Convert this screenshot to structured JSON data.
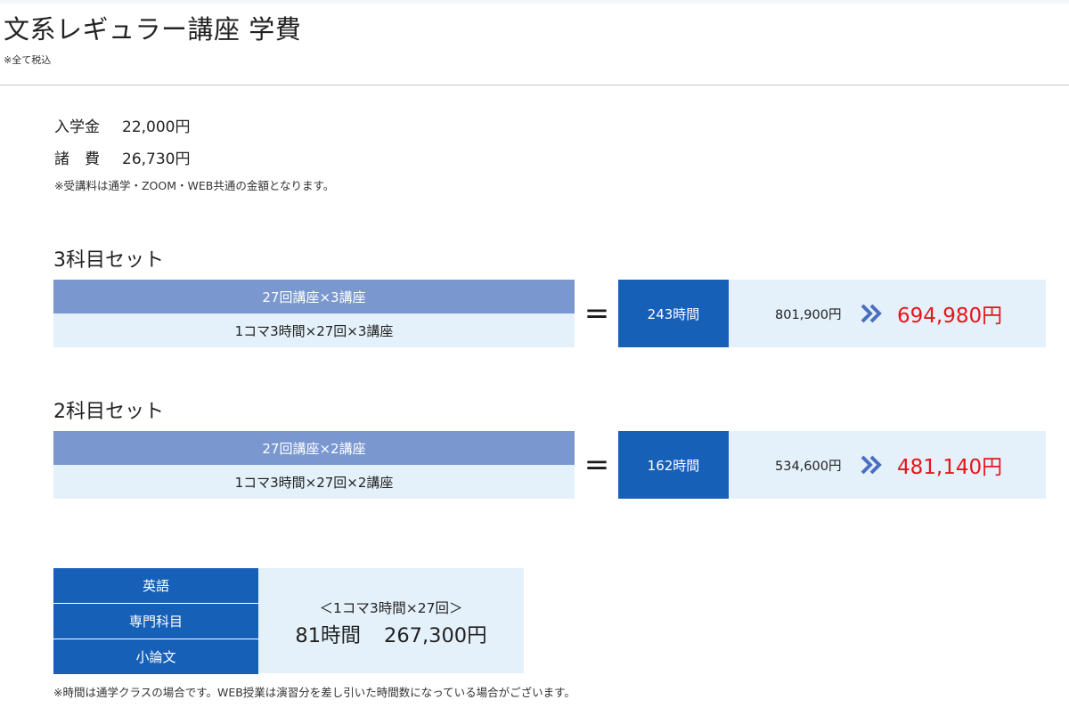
{
  "header": {
    "title": "文系レギュラー講座 学費",
    "tax_note": "※全て税込"
  },
  "fees": {
    "entrance_label": "入学金",
    "entrance_value": "22,000円",
    "misc_label": "諸　費",
    "misc_value": "26,730円",
    "note": "※受講料は通学・ZOOM・WEB共通の金額となります。"
  },
  "sets": [
    {
      "title": "3科目セット",
      "calc_top": "27回講座×3講座",
      "calc_bottom": "1コマ3時間×27回×3講座",
      "equals": "=",
      "hours": "243時間",
      "original_price": "801,900円",
      "sale_price": "694,980円"
    },
    {
      "title": "2科目セット",
      "calc_top": "27回講座×2講座",
      "calc_bottom": "1コマ3時間×27回×2講座",
      "equals": "=",
      "hours": "162時間",
      "original_price": "534,600円",
      "sale_price": "481,140円"
    }
  ],
  "single": {
    "subjects": [
      "英語",
      "専門科目",
      "小論文"
    ],
    "caption": "＜1コマ3時間×27回＞",
    "hours": "81時間",
    "price": "267,300円"
  },
  "footnote": "※時間は通学クラスの場合です。WEB授業は演習分を差し引いた時間数になっている場合がございます。",
  "icons": {
    "arrow": "double-chevron-right-icon"
  },
  "colors": {
    "accent_blue": "#1760b8",
    "light_blue_header": "#7a98cf",
    "pale_blue": "#e4f1fa",
    "sale_red": "#e8141a",
    "arrow_blue": "#4a6fc0"
  }
}
